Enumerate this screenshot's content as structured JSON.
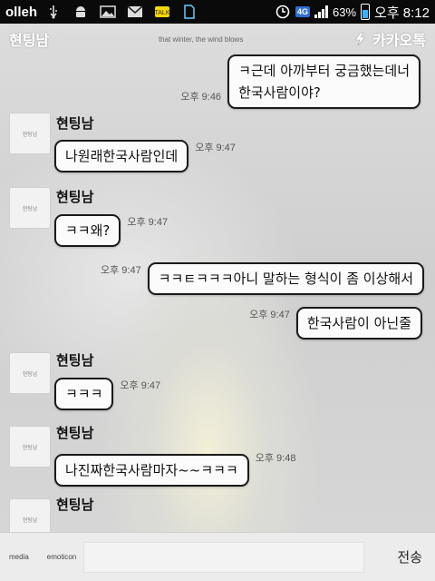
{
  "status_bar": {
    "carrier": "olleh",
    "network": "4G",
    "battery": "63%",
    "time": "오후 8:12",
    "icons": [
      "usb-icon",
      "android-icon",
      "image-icon",
      "mail-icon",
      "kakaotalk-icon",
      "sim-icon",
      "alarm-icon",
      "signal-icon",
      "battery-icon"
    ]
  },
  "header": {
    "room_name": "현팅남",
    "subtitle": "that winter, the wind blows",
    "brand": "카카오톡"
  },
  "messages": [
    {
      "side": "me",
      "text1": "ㅋ근데 아까부터 궁금했는데너",
      "text2": "한국사람이야?",
      "time": "오후 9:46"
    },
    {
      "side": "them",
      "sender": "현팅남",
      "avatar": "현팅남",
      "text": "나원래한국사람인데",
      "time": "오후 9:47"
    },
    {
      "side": "them",
      "sender": "현팅남",
      "avatar": "현팅남",
      "text": "ㅋㅋ왜?",
      "time": "오후 9:47"
    },
    {
      "side": "me",
      "text": "ㅋㅋㅌㅋㅋㅋ아니 말하는 형식이 좀 이상해서",
      "time": "오후 9:47"
    },
    {
      "side": "me",
      "text": "한국사람이 아닌줄",
      "time": "오후 9:47"
    },
    {
      "side": "them",
      "sender": "현팅남",
      "avatar": "현팅남",
      "text": "ㅋㅋㅋ",
      "time": "오후 9:47"
    },
    {
      "side": "them",
      "sender": "현팅남",
      "avatar": "현팅남",
      "text": "나진짜한국사람마자~~ㅋㅋㅋ",
      "time": "오후 9:48"
    },
    {
      "side": "them",
      "sender": "현팅남",
      "avatar": "현팅남"
    }
  ],
  "input_bar": {
    "media_label": "media",
    "emoticon_label": "emoticon",
    "send_label": "전송"
  }
}
